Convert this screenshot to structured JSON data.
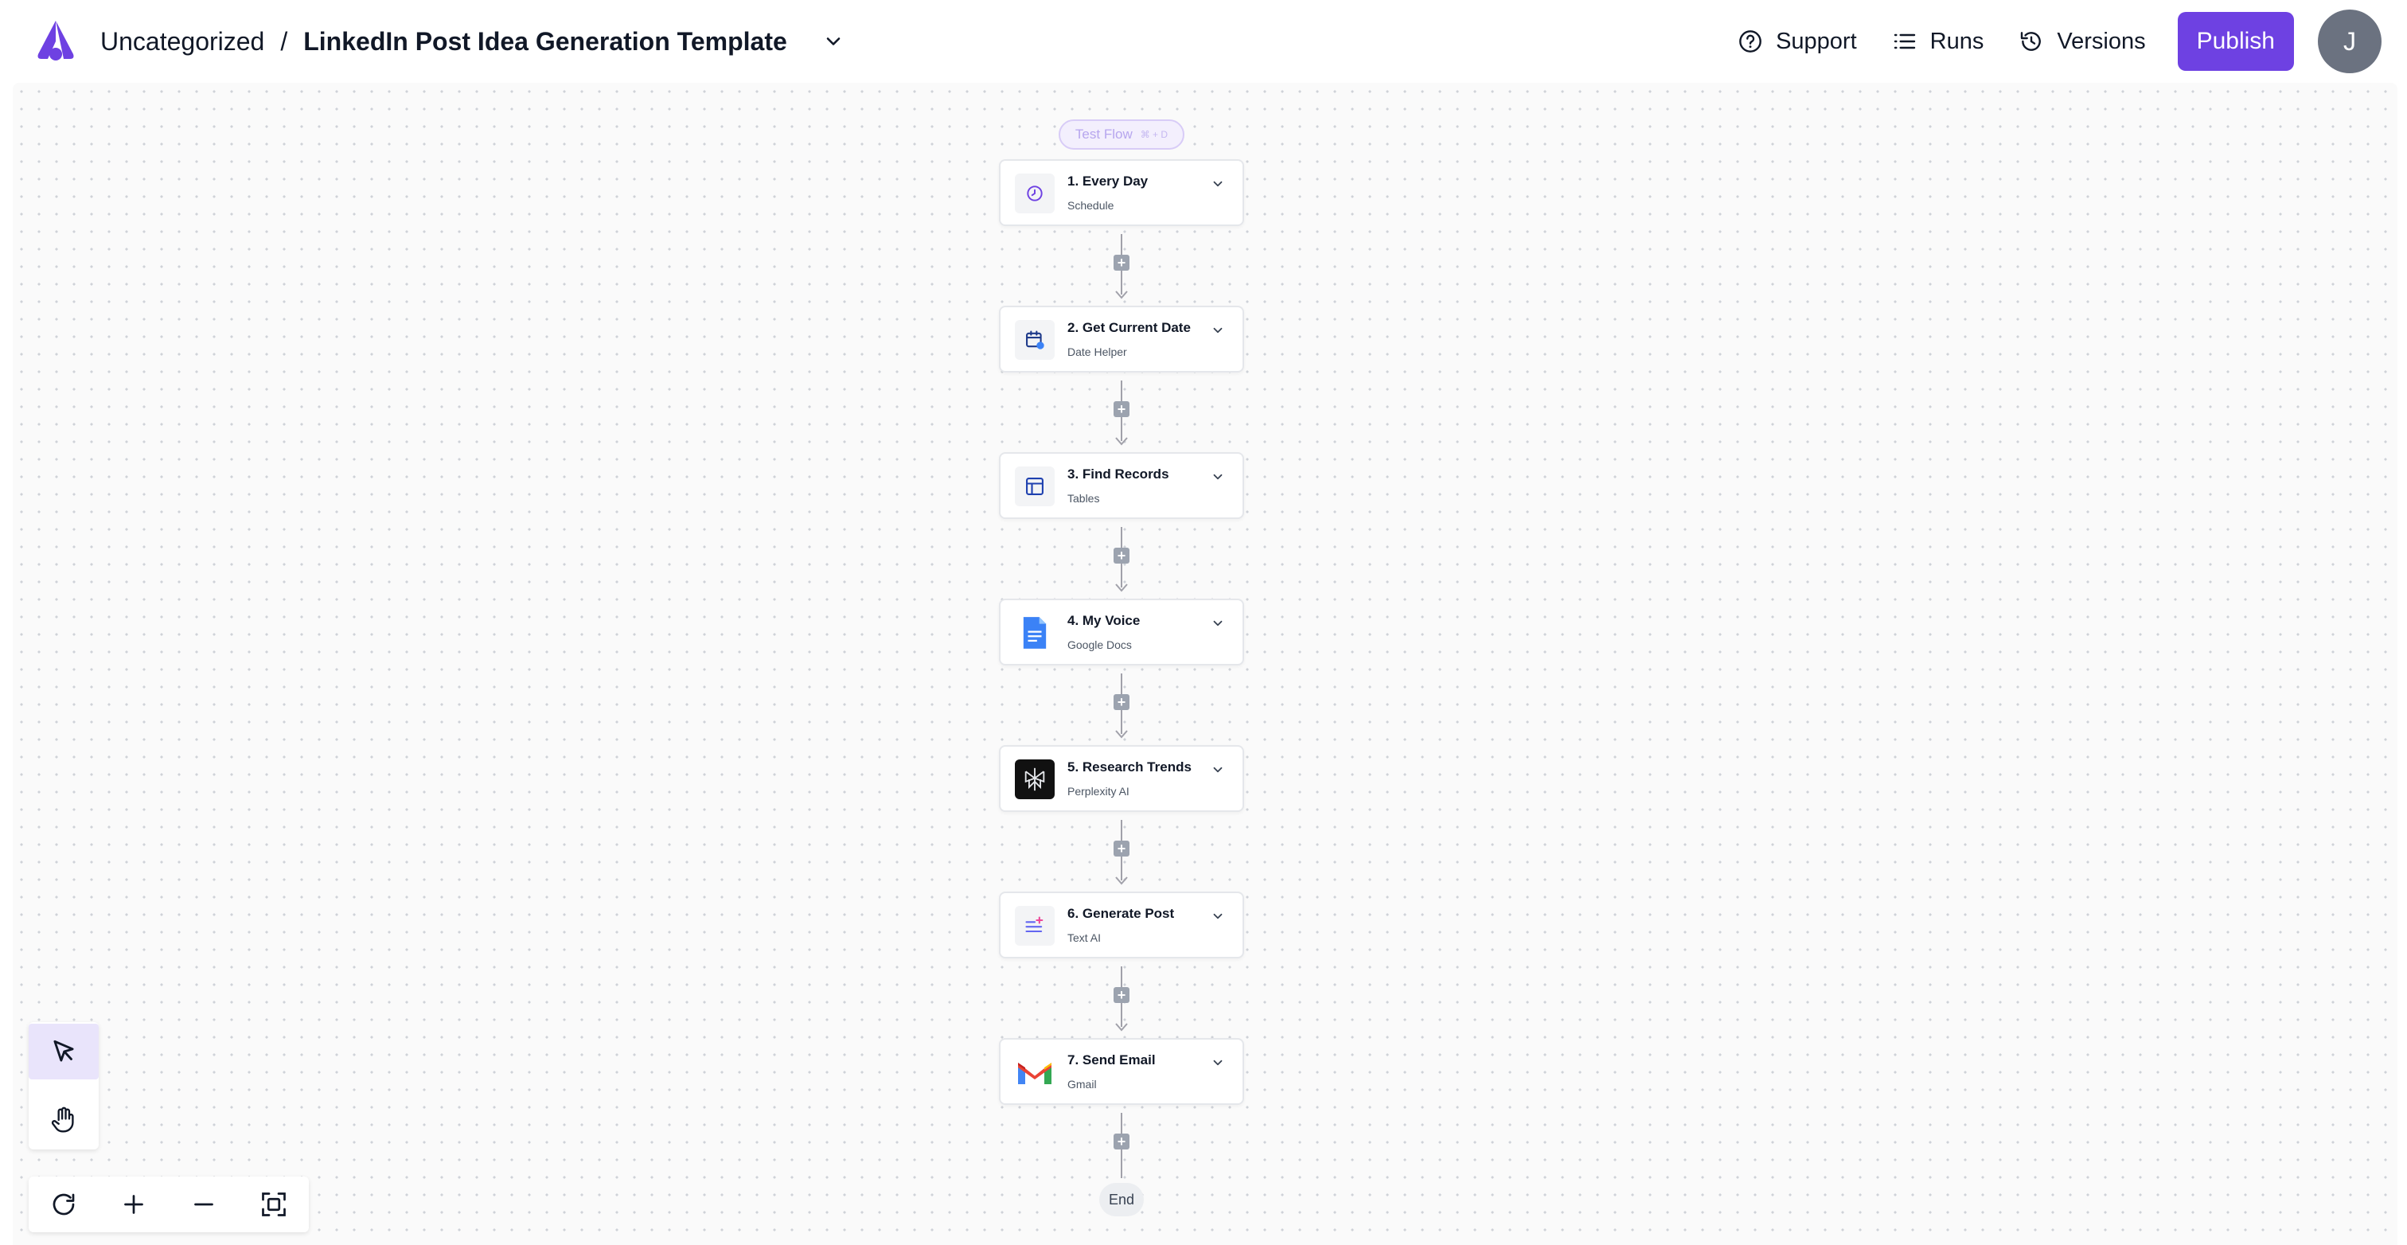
{
  "header": {
    "folder": "Uncategorized",
    "separator": "/",
    "flow_title": "LinkedIn Post Idea Generation Template",
    "support_label": "Support",
    "runs_label": "Runs",
    "versions_label": "Versions",
    "publish_label": "Publish",
    "avatar_initial": "J"
  },
  "colors": {
    "accent": "#6e41e2",
    "avatar_bg": "#6b7280",
    "canvas_bg": "#fafafa"
  },
  "canvas": {
    "test_flow_label": "Test Flow",
    "test_flow_shortcut": "⌘ + D",
    "end_label": "End",
    "steps": [
      {
        "title": "1. Every Day",
        "subtitle": "Schedule",
        "icon": "schedule-icon"
      },
      {
        "title": "2. Get Current Date",
        "subtitle": "Date Helper",
        "icon": "calendar-icon"
      },
      {
        "title": "3. Find Records",
        "subtitle": "Tables",
        "icon": "table-icon"
      },
      {
        "title": "4. My Voice",
        "subtitle": "Google Docs",
        "icon": "google-docs-icon"
      },
      {
        "title": "5. Research Trends",
        "subtitle": "Perplexity AI",
        "icon": "perplexity-icon"
      },
      {
        "title": "6. Generate Post",
        "subtitle": "Text AI",
        "icon": "text-ai-icon"
      },
      {
        "title": "7. Send Email",
        "subtitle": "Gmail",
        "icon": "gmail-icon"
      }
    ]
  },
  "tools": {
    "active": "select",
    "items": [
      "pointer-icon",
      "hand-icon"
    ]
  },
  "zoom_controls": [
    "reset-icon",
    "zoom-in-icon",
    "zoom-out-icon",
    "fit-view-icon"
  ]
}
